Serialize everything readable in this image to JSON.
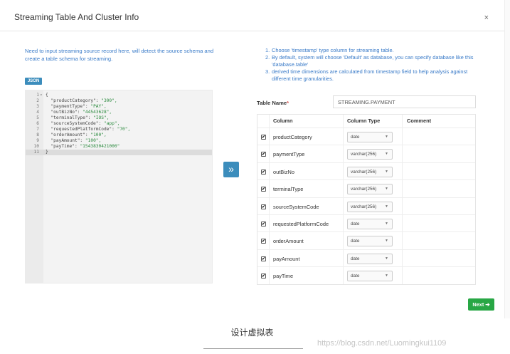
{
  "modal": {
    "title": "Streaming Table And Cluster Info",
    "close_label": "×"
  },
  "left": {
    "hint": "Need to input streaming source record here, will detect the source schema and create a table schema for streaming.",
    "badge": "JSON",
    "code_lines": [
      {
        "n": "1",
        "fold": "▾",
        "text": "{"
      },
      {
        "n": "2",
        "fold": "",
        "key": "  \"productCategory\": ",
        "val": "\"300\","
      },
      {
        "n": "3",
        "fold": "",
        "key": "  \"paymentType\": ",
        "val": "\"PAY\","
      },
      {
        "n": "4",
        "fold": "",
        "key": "  \"outBizNo\": ",
        "val": "\"44543628\","
      },
      {
        "n": "5",
        "fold": "",
        "key": "  \"terminalType\": ",
        "val": "\"IOS\","
      },
      {
        "n": "6",
        "fold": "",
        "key": "  \"sourceSystemCode\": ",
        "val": "\"app\","
      },
      {
        "n": "7",
        "fold": "",
        "key": "  \"requestedPlatformCode\": ",
        "val": "\"70\","
      },
      {
        "n": "8",
        "fold": "",
        "key": "  \"orderAmount\": ",
        "val": "\"100\","
      },
      {
        "n": "9",
        "fold": "",
        "key": "  \"payAmount\": ",
        "val": "\"100\","
      },
      {
        "n": "10",
        "fold": "",
        "key": "  \"payTime\": ",
        "val": "\"1543830421000\""
      },
      {
        "n": "11",
        "fold": "",
        "text": "}"
      }
    ]
  },
  "transfer_button": "»",
  "right": {
    "hints": [
      {
        "num": "1.",
        "text": "Choose 'timestamp' type column for streaming table."
      },
      {
        "num": "2.",
        "text": "By default, system will choose 'Default' as database, you can specify database like this 'database.table'"
      },
      {
        "num": "3.",
        "text": "derived time dimensions are calculated from timestamp field to help analysis against different time granularities."
      }
    ],
    "table_name_label": "Table Name",
    "required_mark": "*",
    "table_name_value": "STREAMING.PAYMENT",
    "columns_header": {
      "column": "Column",
      "type": "Column Type",
      "comment": "Comment"
    },
    "rows": [
      {
        "name": "productCategory",
        "type": "date",
        "checked": "✔"
      },
      {
        "name": "paymentType",
        "type": "varchar(256)",
        "checked": "✔"
      },
      {
        "name": "outBizNo",
        "type": "varchar(256)",
        "checked": "✔"
      },
      {
        "name": "terminalType",
        "type": "varchar(256)",
        "checked": "✔"
      },
      {
        "name": "sourceSystemCode",
        "type": "varchar(256)",
        "checked": "✔"
      },
      {
        "name": "requestedPlatformCode",
        "type": "date",
        "checked": "✔"
      },
      {
        "name": "orderAmount",
        "type": "date",
        "checked": "✔"
      },
      {
        "name": "payAmount",
        "type": "date",
        "checked": "✔"
      },
      {
        "name": "payTime",
        "type": "date",
        "checked": "✔"
      }
    ],
    "caret": "▼"
  },
  "next_button": "Next ➔",
  "caption": "设计虚拟表",
  "watermark": "https://blog.csdn.net/Luomingkui1109"
}
